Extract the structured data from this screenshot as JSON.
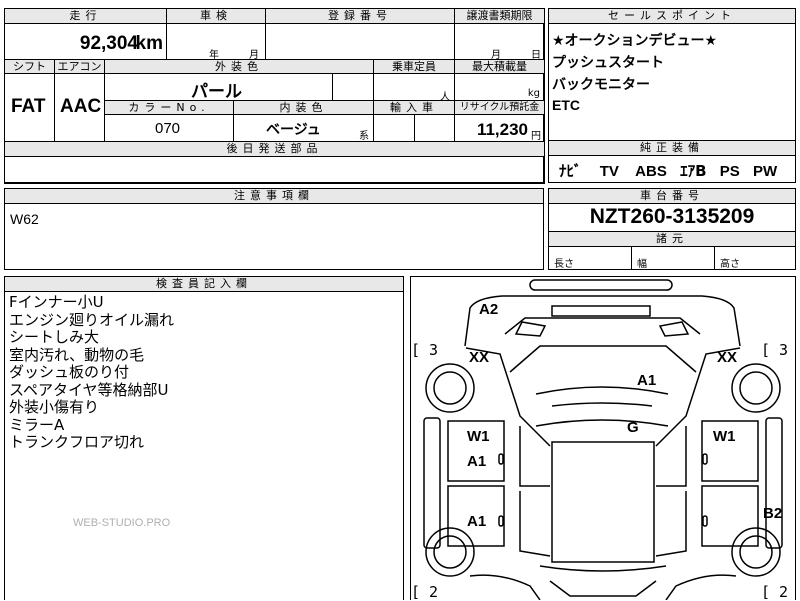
{
  "top": {
    "headers": {
      "mileage": "走行",
      "inspection": "車検",
      "reg_no": "登録番号",
      "transfer": "譲渡書類期限",
      "sales_points": "セールスポイント"
    },
    "mileage_value": "92,304",
    "mileage_unit": "km",
    "inspection_year": "年",
    "inspection_month": "月",
    "transfer_month": "月",
    "transfer_day": "日"
  },
  "sales_points": [
    "★オークションデビュー★",
    "プッシュスタート",
    "バックモニター",
    "ETC"
  ],
  "spec": {
    "headers": {
      "shift": "シフト",
      "aircon": "エアコン",
      "exterior_color": "外装色",
      "capacity": "乗車定員",
      "max_load": "最大積載量",
      "color_no": "カラーNo.",
      "interior_color": "内装色",
      "import": "輸入車",
      "recycle": "リサイクル預託金"
    },
    "shift_value": "FAT",
    "aircon_value": "AAC",
    "exterior_color_value": "パール",
    "capacity_unit": "人",
    "max_load_unit": "kg",
    "color_no_value": "070",
    "interior_color_value": "ベージュ",
    "interior_color_suffix": "系",
    "recycle_value": "11,230",
    "recycle_unit": "円",
    "later_parts_header": "後日発送部品"
  },
  "equipment": {
    "header": "純正装備",
    "items": [
      "ﾅﾋﾞ",
      "TV",
      "ABS",
      "ｴｱB",
      "PS",
      "PW"
    ]
  },
  "caution": {
    "header": "注意事項欄",
    "text": "W62"
  },
  "chassis": {
    "header": "車台番号",
    "value": "NZT260-3135209",
    "dims_header": "諸元",
    "length_label": "長さ",
    "width_label": "幅",
    "height_label": "高さ"
  },
  "inspector": {
    "header": "検査員記入欄",
    "lines": [
      "Fインナー小U",
      "エンジン廻りオイル漏れ",
      "シートしみ大",
      "室内汚れ、動物の毛",
      "ダッシュ板のり付",
      "スペアタイヤ等格納部U",
      "外装小傷有り",
      "ミラーA",
      "トランクフロア切れ"
    ],
    "watermark": "WEB-STUDIO.PRO"
  },
  "diagram": {
    "side_left_top": "[ 3",
    "side_right_top": "[ 3",
    "side_left_bottom": "[ 2",
    "side_right_bottom": "[ 2",
    "labels": {
      "a2": "A2",
      "xx_left": "XX",
      "xx_right": "XX",
      "a1_top": "A1",
      "g": "G",
      "w1_left": "W1",
      "w1_right": "W1",
      "a1_left_front": "A1",
      "a1_left_rear": "A1",
      "b2": "B2"
    }
  }
}
